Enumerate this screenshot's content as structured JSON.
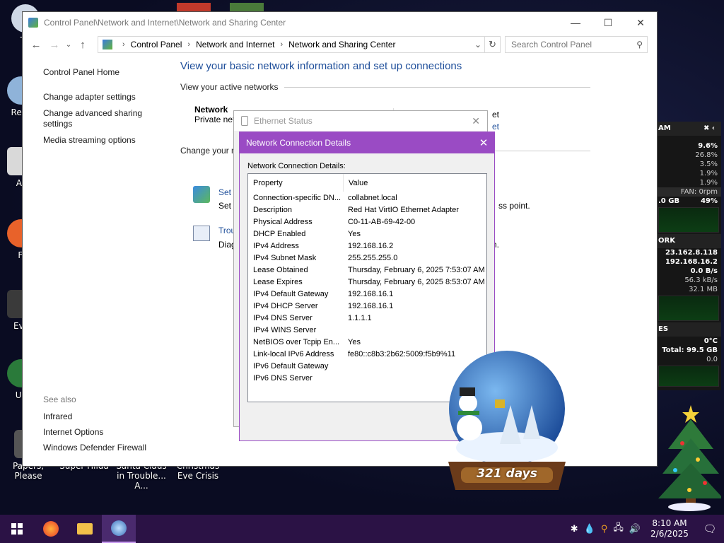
{
  "desktop": {
    "icons": [
      {
        "label": "Th",
        "color": "#cfd8e6"
      },
      {
        "label": "Recy",
        "color": "#8fb3d9"
      },
      {
        "label": "Ac",
        "color": "#d9d9d9"
      },
      {
        "label": "Fi",
        "color": "#e8622a"
      },
      {
        "label": "Eve",
        "color": "#3a3a3a"
      },
      {
        "label": "Un",
        "color": "#2a7a3a"
      },
      {
        "label": "Papers, Please",
        "color": "#555"
      }
    ],
    "bottom_labels": [
      "Super Hilda",
      "Santa Claus in Trouble... A...",
      "Christmas Eve Crisis"
    ]
  },
  "control_panel": {
    "title": "Control Panel\\Network and Internet\\Network and Sharing Center",
    "breadcrumb": [
      "Control Panel",
      "Network and Internet",
      "Network and Sharing Center"
    ],
    "search_placeholder": "Search Control Panel",
    "left_nav": [
      "Control Panel Home",
      "Change adapter settings",
      "Change advanced sharing settings",
      "Media streaming options"
    ],
    "see_also_heading": "See also",
    "see_also": [
      "Infrared",
      "Internet Options",
      "Windows Defender Firewall"
    ],
    "heading": "View your basic network information and set up connections",
    "active_networks": "View your active networks",
    "network_name": "Network",
    "network_type": "Private net",
    "access_type_partial": "et",
    "connections_partial": "et",
    "change_settings": "Change your n",
    "setup_link": "Set u",
    "setup_desc": "Set u",
    "setup_desc_tail": "ss point.",
    "troubleshoot_link": "Trou",
    "troubleshoot_desc": "Diag",
    "troubleshoot_tail": "n."
  },
  "ethernet_status": {
    "title": "Ethernet Status"
  },
  "details": {
    "title": "Network Connection Details",
    "label": "Network Connection Details:",
    "col_property": "Property",
    "col_value": "Value",
    "rows": [
      {
        "p": "Connection-specific DN...",
        "v": "collabnet.local"
      },
      {
        "p": "Description",
        "v": "Red Hat VirtIO Ethernet Adapter"
      },
      {
        "p": "Physical Address",
        "v": "C0-11-AB-69-42-00"
      },
      {
        "p": "DHCP Enabled",
        "v": "Yes"
      },
      {
        "p": "IPv4 Address",
        "v": "192.168.16.2"
      },
      {
        "p": "IPv4 Subnet Mask",
        "v": "255.255.255.0"
      },
      {
        "p": "Lease Obtained",
        "v": "Thursday, February 6, 2025 7:53:07 AM"
      },
      {
        "p": "Lease Expires",
        "v": "Thursday, February 6, 2025 8:53:07 AM"
      },
      {
        "p": "IPv4 Default Gateway",
        "v": "192.168.16.1"
      },
      {
        "p": "IPv4 DHCP Server",
        "v": "192.168.16.1"
      },
      {
        "p": "IPv4 DNS Server",
        "v": "1.1.1.1"
      },
      {
        "p": "IPv4 WINS Server",
        "v": ""
      },
      {
        "p": "NetBIOS over Tcpip En...",
        "v": "Yes"
      },
      {
        "p": "Link-local IPv6 Address",
        "v": "fe80::c8b3:2b62:5009:f5b9%11"
      },
      {
        "p": "IPv6 Default Gateway",
        "v": ""
      },
      {
        "p": "IPv6 DNS Server",
        "v": ""
      }
    ]
  },
  "widget": {
    "ram_header": "AM",
    "cpu_total": "9.6%",
    "cpu_vals": [
      "26.8%",
      "3.5%",
      "1.9%",
      "1.9%"
    ],
    "fan": "FAN: 0rpm",
    "mem": ".0 GB",
    "mem_pct": "49%",
    "net_header": "ORK",
    "ext_ip": "23.162.8.118",
    "int_ip": "192.168.16.2",
    "net_rate": "0.0 B/s",
    "net_up": "56.3 kB/s",
    "net_total": "32.1 MB",
    "disk_header": "ES",
    "temp": "0°C",
    "disk_total": "Total: 99.5 GB",
    "disk_free": "0.0"
  },
  "globe": {
    "days": "321 days"
  },
  "taskbar": {
    "time": "8:10 AM",
    "date": "2/6/2025"
  }
}
